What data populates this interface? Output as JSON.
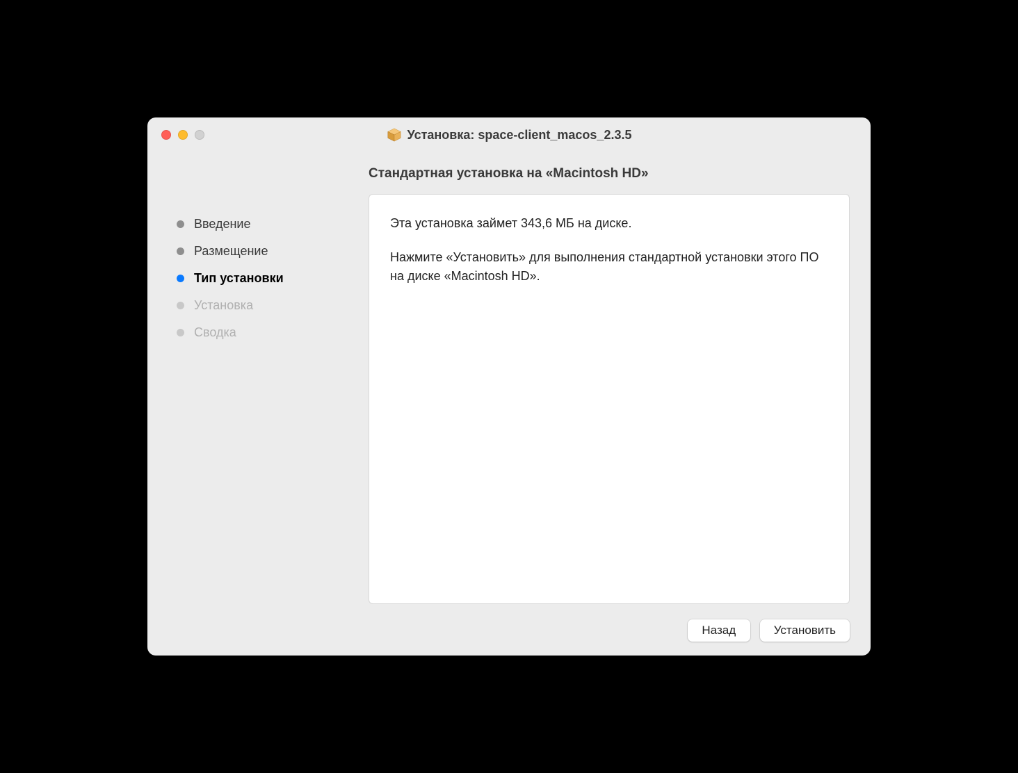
{
  "window": {
    "title": "Установка: space-client_macos_2.3.5"
  },
  "subtitle": "Стандартная установка на «Macintosh HD»",
  "steps": {
    "intro": {
      "label": "Введение",
      "state": "done"
    },
    "dest": {
      "label": "Размещение",
      "state": "done"
    },
    "type": {
      "label": "Тип установки",
      "state": "current"
    },
    "install": {
      "label": "Установка",
      "state": "pending"
    },
    "summary": {
      "label": "Сводка",
      "state": "pending"
    }
  },
  "content": {
    "line1": "Эта установка займет 343,6 МБ на диске.",
    "line2": "Нажмите «Установить» для выполнения стандартной установки этого ПО на диске «Macintosh HD»."
  },
  "buttons": {
    "back": "Назад",
    "install": "Установить"
  }
}
